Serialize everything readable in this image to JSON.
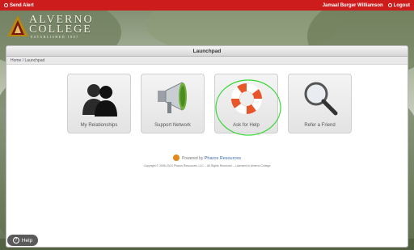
{
  "topbar": {
    "send_alert": "Send Alert",
    "user_name": "Jamaal Burger Williamson",
    "logout": "Logout",
    "color": "#cc1c1c"
  },
  "logo": {
    "wordmark_line1": "ALVERNO",
    "wordmark_line2": "COLLEGE",
    "tagline": "ESTABLISHED 1887"
  },
  "panel": {
    "title": "Launchpad",
    "breadcrumb": {
      "home": "Home",
      "separator": " / ",
      "current": "Launchpad"
    }
  },
  "tiles": [
    {
      "label": "My Relationships",
      "icon": "people-icon"
    },
    {
      "label": "Support Network",
      "icon": "megaphone-icon"
    },
    {
      "label": "Ask for Help",
      "icon": "life-preserver-icon"
    },
    {
      "label": "Refer a Friend",
      "icon": "magnifier-icon"
    }
  ],
  "footer": {
    "powered_by": "Powered by",
    "brand": "Pharos Resources",
    "copyright": "Copyright © 2006-2024 Pharos Resources, LLC -- All Rights Reserved -- Licensed to Alverno College"
  },
  "help_button": {
    "label": "Help"
  }
}
